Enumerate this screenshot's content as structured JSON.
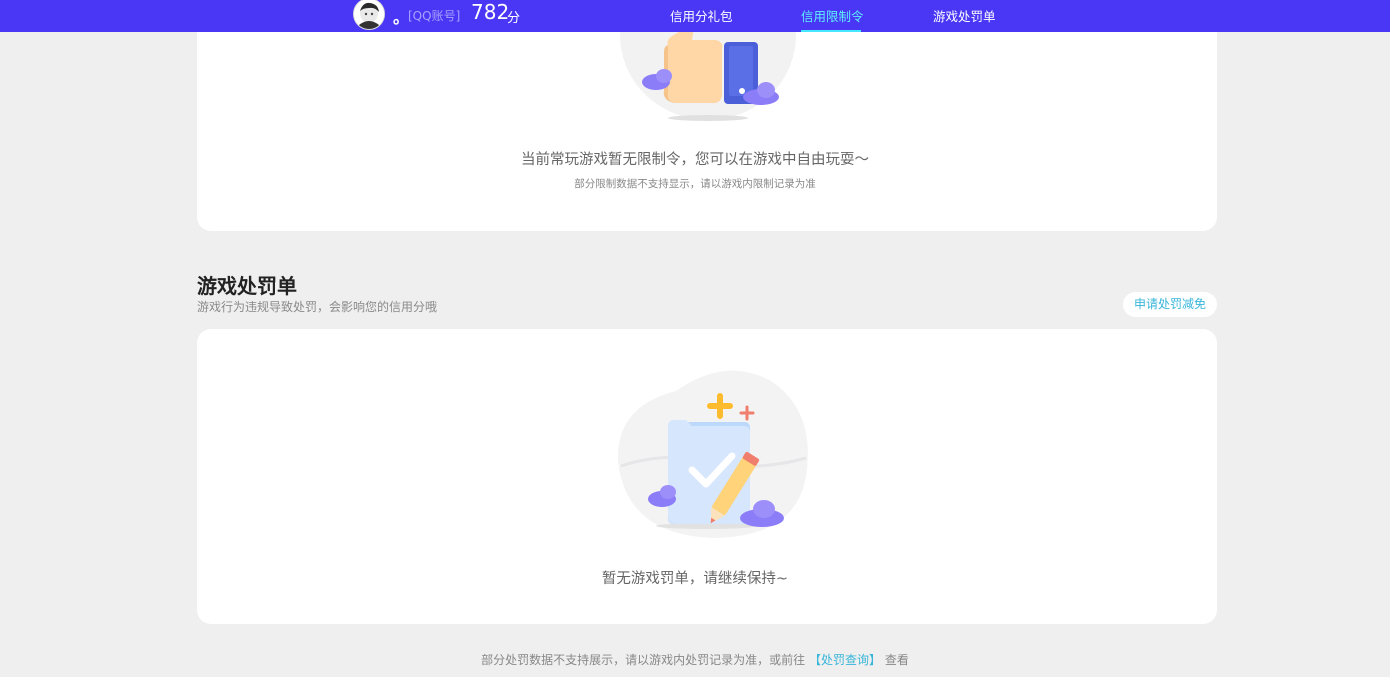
{
  "header": {
    "user_dot": "。",
    "account_label": "[QQ账号]",
    "score": "782",
    "score_unit": "分",
    "tabs": [
      {
        "label": "信用分礼包",
        "active": false
      },
      {
        "label": "信用限制令",
        "active": true
      },
      {
        "label": "游戏处罚单",
        "active": false
      }
    ]
  },
  "restriction": {
    "empty_message": "当前常玩游戏暂无限制令，您可以在游戏中自由玩耍～",
    "empty_note": "部分限制数据不支持显示，请以游戏内限制记录为准"
  },
  "penalty": {
    "title": "游戏处罚单",
    "subtitle": "游戏行为违规导致处罚，会影响您的信用分哦",
    "apply_button": "申请处罚减免",
    "empty_message": "暂无游戏罚单，请继续保持~"
  },
  "footer": {
    "note_prefix": "部分处罚数据不支持展示，请以游戏内处罚记录为准，或前往",
    "link_label": "【处罚查询】",
    "note_suffix": "查看"
  },
  "colors": {
    "topbar": "#4a37f5",
    "active_tab": "#5ef0ff",
    "accent_link": "#38b6d9",
    "background": "#efefef"
  },
  "icons": [
    "avatar",
    "thumbs-up-illustration",
    "clipboard-check-illustration"
  ]
}
